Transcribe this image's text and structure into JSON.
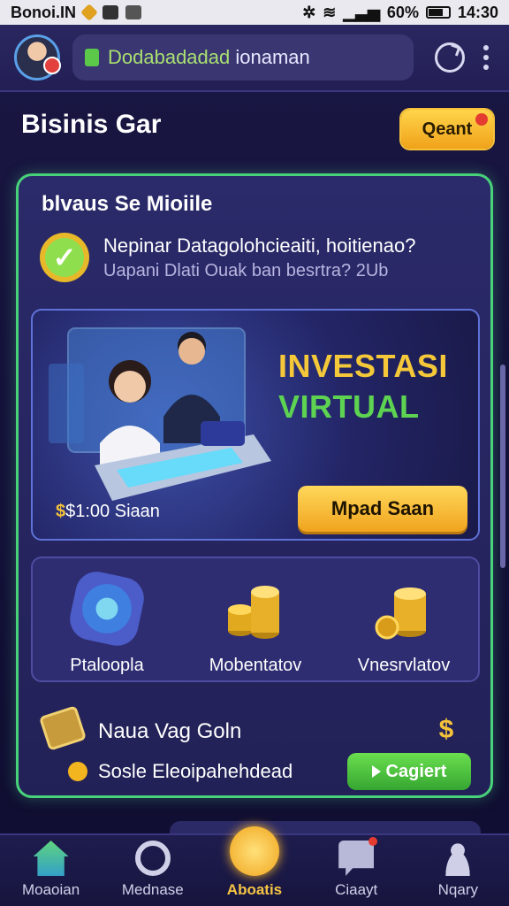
{
  "status_bar": {
    "carrier": "Bonoi.IN",
    "battery": "60%",
    "time": "14:30"
  },
  "app_bar": {
    "search_text_accent": "Dodabadadad",
    "search_text": "ionaman"
  },
  "page": {
    "title": "Bisinis Gar",
    "quest_label": "Qeant"
  },
  "card": {
    "title": "blvaus Se Mioiile",
    "question_line1": "Nepinar Datagolohcieaiti, hoitienao?",
    "question_line2": "Uapani Dlati Ouak ban besrtra? 2Ub"
  },
  "hero": {
    "title_line1": "INVESTASI",
    "title_line2": "VIRTUAL",
    "price_coin": "$",
    "price": "$1:00 Siaan",
    "button_label": "Mpad Saan"
  },
  "features": [
    {
      "label": "Ptaloopla",
      "icon": "shield-coin-icon"
    },
    {
      "label": "Mobentatov",
      "icon": "coin-stack-icon"
    },
    {
      "label": "Vnesrvlatov",
      "icon": "coin-stack-icon"
    }
  ],
  "bonus": {
    "title": "Naua Vag Goln",
    "subtitle": "Sosle Eleoipahehdead",
    "button_label": "Cagiert"
  },
  "nav": [
    {
      "label": "Moaoian",
      "icon": "home-icon",
      "active": false
    },
    {
      "label": "Mednase",
      "icon": "media-icon",
      "active": false
    },
    {
      "label": "Aboatis",
      "icon": "center-icon",
      "active": true
    },
    {
      "label": "Ciaayt",
      "icon": "chat-icon",
      "active": false
    },
    {
      "label": "Nqary",
      "icon": "user-icon",
      "active": false
    }
  ],
  "colors": {
    "accent": "#f3c13a",
    "success": "#48d27a",
    "background": "#1a1744"
  }
}
